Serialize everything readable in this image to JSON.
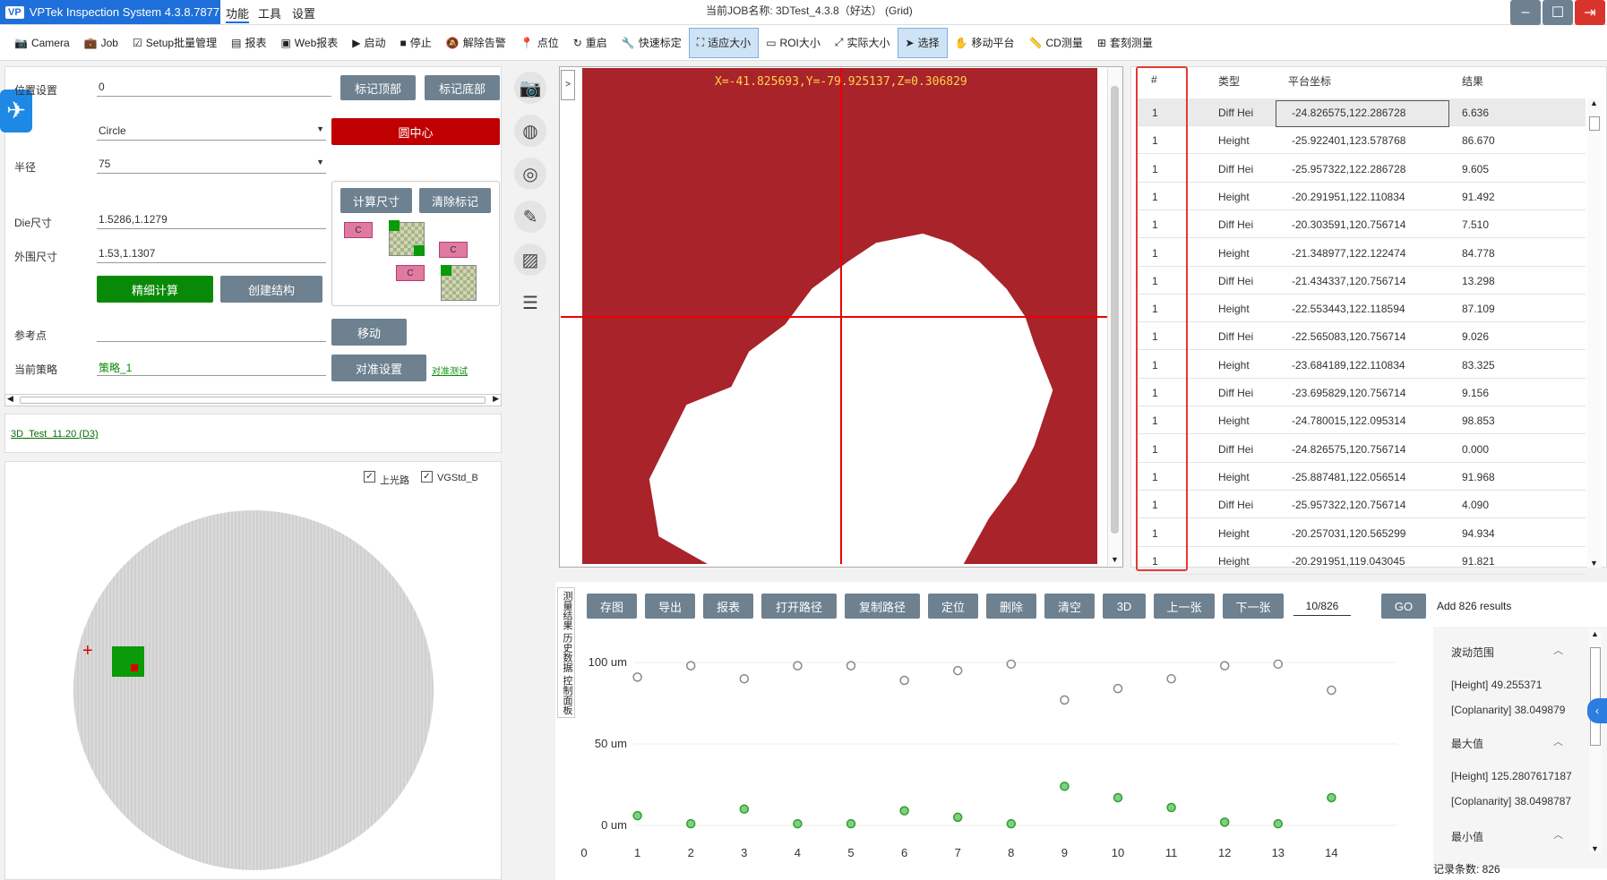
{
  "titlebar": {
    "app": "VPTek Inspection System 4.3.8.7877",
    "menus": [
      "功能",
      "工具",
      "设置"
    ],
    "job": "当前JOB名称: 3DTest_4.3.8（好达） (Grid)"
  },
  "toolbar": [
    "Camera",
    "Job",
    "Setup批量管理",
    "报表",
    "Web报表",
    "启动",
    "停止",
    "解除告警",
    "点位",
    "重启",
    "快速标定",
    "适应大小",
    "ROI大小",
    "实际大小",
    "选择",
    "移动平台",
    "CD测量",
    "套刻测量"
  ],
  "left": {
    "row1_label": "位置设置",
    "row1_value": "0",
    "btn_top": "标记顶部",
    "btn_bottom": "标记底部",
    "shape_value": "Circle",
    "btn_center": "圆中心",
    "radius_label": "半径",
    "radius_value": "75",
    "btn_calc": "计算尺寸",
    "btn_clear": "清除标记",
    "die_label": "Die尺寸",
    "die_value": "1.5286,1.1279",
    "outer_label": "外围尺寸",
    "outer_value": "1.53,1.1307",
    "btn_fine": "精细计算",
    "btn_create": "创建结构",
    "ref_label": "参考点",
    "btn_move": "移动",
    "strategy_label": "当前策略",
    "strategy_value": "策略_1",
    "btn_align": "对准设置",
    "align_test": "对准测试",
    "chip_c": "C"
  },
  "recipe_link": "3D_Test_11.20 (D3)",
  "wafer": {
    "check1": "上光路",
    "check2": "VGStd_B"
  },
  "viewer": {
    "coords": "X=-41.825693,Y=-79.925137,Z=0.306829",
    "expand": ">"
  },
  "table": {
    "headers": [
      "#",
      "类型",
      "平台坐标",
      "结果"
    ],
    "rows": [
      [
        "1",
        "Diff Hei",
        "-24.826575,122.286728",
        "6.636"
      ],
      [
        "1",
        "Height",
        "-25.922401,123.578768",
        "86.670"
      ],
      [
        "1",
        "Diff Hei",
        "-25.957322,122.286728",
        "9.605"
      ],
      [
        "1",
        "Height",
        "-20.291951,122.110834",
        "91.492"
      ],
      [
        "1",
        "Diff Hei",
        "-20.303591,120.756714",
        "7.510"
      ],
      [
        "1",
        "Height",
        "-21.348977,122.122474",
        "84.778"
      ],
      [
        "1",
        "Diff Hei",
        "-21.434337,120.756714",
        "13.298"
      ],
      [
        "1",
        "Height",
        "-22.553443,122.118594",
        "87.109"
      ],
      [
        "1",
        "Diff Hei",
        "-22.565083,120.756714",
        "9.026"
      ],
      [
        "1",
        "Height",
        "-23.684189,122.110834",
        "83.325"
      ],
      [
        "1",
        "Diff Hei",
        "-23.695829,120.756714",
        "9.156"
      ],
      [
        "1",
        "Height",
        "-24.780015,122.095314",
        "98.853"
      ],
      [
        "1",
        "Diff Hei",
        "-24.826575,120.756714",
        "0.000"
      ],
      [
        "1",
        "Height",
        "-25.887481,122.056514",
        "91.968"
      ],
      [
        "1",
        "Diff Hei",
        "-25.957322,120.756714",
        "4.090"
      ],
      [
        "1",
        "Height",
        "-20.257031,120.565299",
        "94.934"
      ],
      [
        "1",
        "Height",
        "-20.291951,119.043045",
        "91.821"
      ]
    ]
  },
  "bottom": {
    "buttons": [
      "存图",
      "导出",
      "报表",
      "打开路径",
      "复制路径",
      "定位",
      "删除",
      "清空",
      "3D",
      "上一张",
      "下一张"
    ],
    "counter": "10/826",
    "go": "GO",
    "added": "Add 826 results",
    "vtabs": [
      "测量结果",
      "历史数据",
      "控制面板"
    ],
    "records": "记录条数: 826"
  },
  "stats": {
    "range_title": "波动范围",
    "range_height": "[Height]   49.255371",
    "range_cop": "[Coplanarity]   38.049879",
    "max_title": "最大值",
    "max_height": "[Height]   125.2807617187",
    "max_cop": "[Coplanarity]   38.0498787",
    "min_title": "最小值"
  },
  "chart_data": {
    "type": "scatter",
    "x_ticks": [
      "0",
      "1",
      "2",
      "3",
      "4",
      "5",
      "6",
      "7",
      "8",
      "9",
      "10",
      "11",
      "12",
      "13",
      "14"
    ],
    "y_ticks": [
      "100 um",
      "50 um",
      "0 um"
    ],
    "ylim": [
      0,
      100
    ],
    "series": [
      {
        "color": "#888888",
        "x": [
          1,
          2,
          3,
          4,
          5,
          6,
          7,
          8,
          9,
          10,
          11,
          12,
          13,
          14
        ],
        "y": [
          91,
          98,
          90,
          98,
          98,
          89,
          95,
          99,
          77,
          84,
          90,
          98,
          99,
          83
        ]
      },
      {
        "color": "#2e9e2e",
        "x": [
          1,
          2,
          3,
          4,
          5,
          6,
          7,
          8,
          9,
          10,
          11,
          12,
          13,
          14
        ],
        "y": [
          6,
          1,
          10,
          1,
          1,
          9,
          5,
          1,
          24,
          17,
          11,
          2,
          1,
          17
        ]
      }
    ]
  }
}
